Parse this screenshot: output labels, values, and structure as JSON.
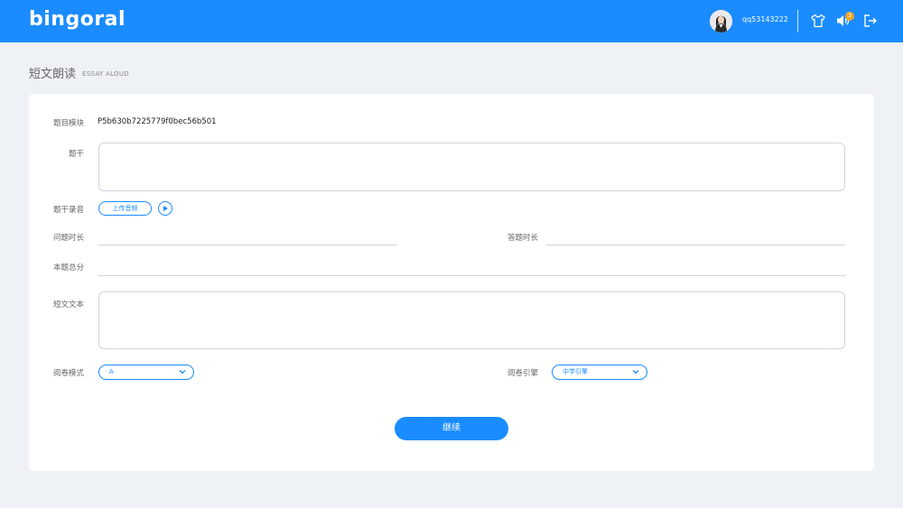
{
  "header": {
    "logo_text": "bingoral",
    "username": "qq53143222",
    "notification_count": "3",
    "icons": [
      "tshirt-icon",
      "speaker-icon",
      "logout-icon"
    ],
    "brand_color": "#1a8cff"
  },
  "page": {
    "title": "短文朗读",
    "subtitle": "ESSAY ALOUD"
  },
  "form": {
    "template_label": "题目模块",
    "template_value": "P5b630b7225779f0bec56b501",
    "stem_label": "题干",
    "stem_value": "",
    "stem_audio_label": "题干录音",
    "upload_button": "上传音频",
    "question_duration_label": "问题时长",
    "question_duration_value": "",
    "answer_duration_label": "答题时长",
    "answer_duration_value": "",
    "total_score_label": "本题总分",
    "total_score_value": "",
    "essay_text_label": "短文文本",
    "essay_text_value": "",
    "grading_mode_label": "阅卷模式",
    "grading_mode_value": "A",
    "grading_engine_label": "阅卷引擎",
    "grading_engine_value": "中学引擎",
    "continue_button": "继续"
  }
}
